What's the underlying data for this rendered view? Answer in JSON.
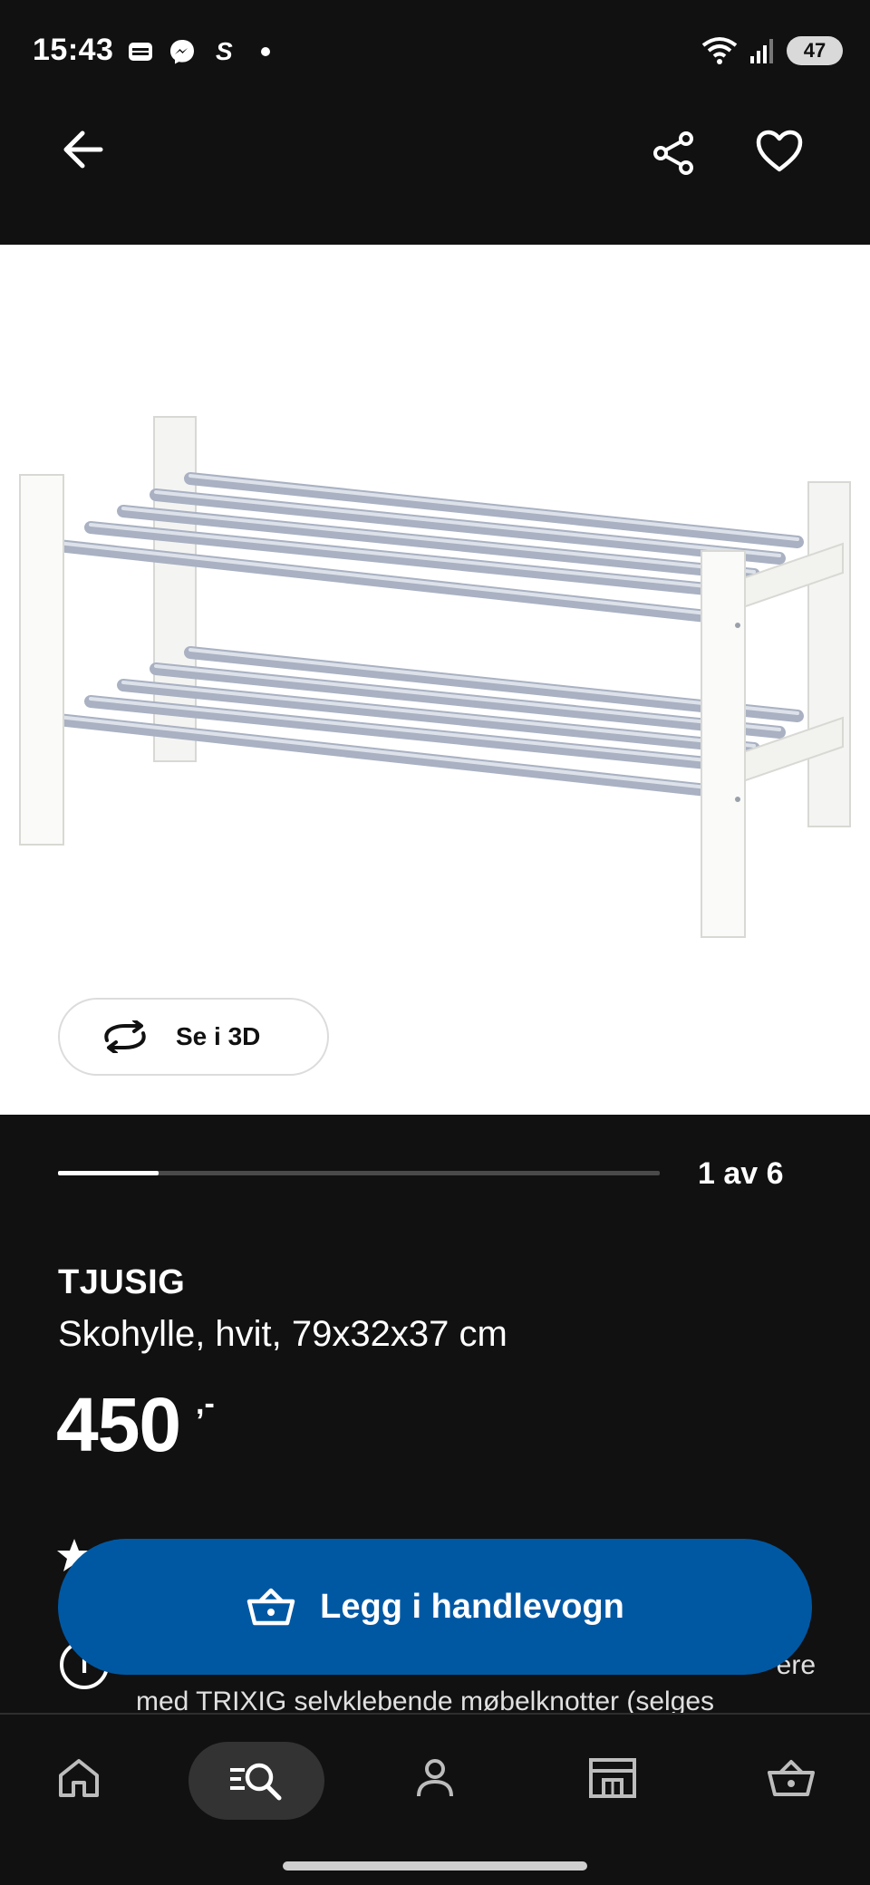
{
  "status_bar": {
    "time": "15:43",
    "battery": "47",
    "icons_left": [
      "wallet-icon",
      "messenger-icon",
      "s-icon",
      "dot-icon"
    ],
    "icons_right": [
      "wifi-icon",
      "signal-icon"
    ]
  },
  "app_bar": {
    "back_icon": "arrow-left-icon",
    "share_icon": "share-icon",
    "favorite_icon": "heart-icon"
  },
  "gallery": {
    "view_3d_label": "Se i 3D",
    "current": 1,
    "total": 6,
    "counter_text": "1 av 6"
  },
  "product": {
    "name": "TJUSIG",
    "description": "Skohylle, hvit, 79x32x37 cm",
    "price": "450",
    "price_suffix": ",-"
  },
  "info": {
    "text_line1": "ere",
    "text_line2": "med TRIXIG selvklebende møbelknotter (selges"
  },
  "cart": {
    "label": "Legg i handlevogn",
    "color": "#0058a3"
  },
  "bottom_nav": {
    "items": [
      "home-icon",
      "search-icon",
      "profile-icon",
      "store-icon",
      "basket-icon"
    ],
    "active": "search-icon"
  }
}
